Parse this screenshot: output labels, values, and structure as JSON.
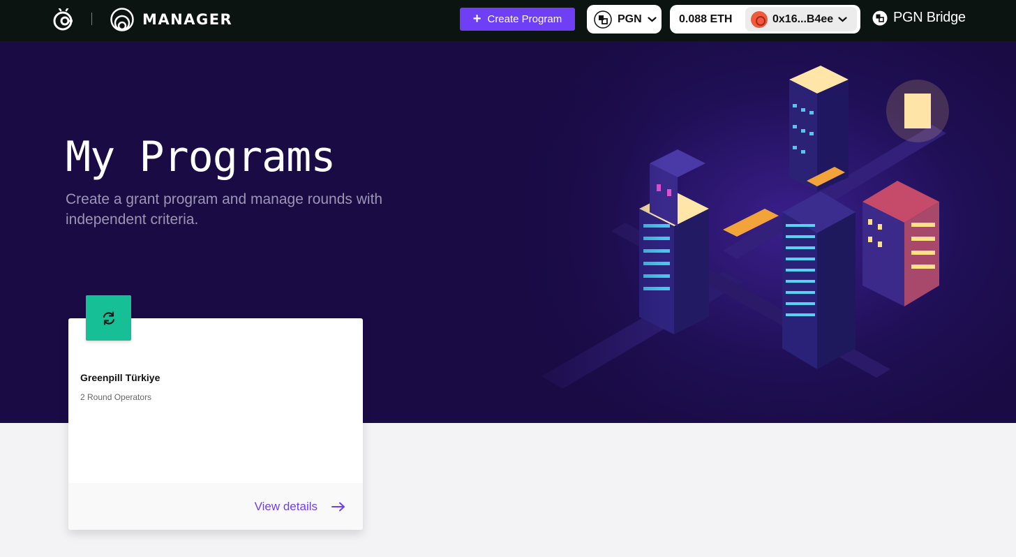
{
  "nav": {
    "brand_text": "MANAGER",
    "create_button_label": "Create Program",
    "network": "PGN",
    "wallet_balance": "0.088 ETH",
    "wallet_address": "0x16...B4ee",
    "bridge_label": "PGN Bridge"
  },
  "hero": {
    "title": "My Programs",
    "subtitle": "Create a grant program and manage rounds with independent criteria."
  },
  "programs": [
    {
      "name": "Greenpill Türkiye",
      "operators": "2 Round Operators",
      "link_label": "View details"
    }
  ],
  "colors": {
    "accent": "#6f3ff5",
    "nav_bg": "#0c1412",
    "hero_bg": "#1a0b45",
    "card_icon_bg": "#17bf96",
    "page_bg": "#f3f3f5"
  },
  "icons": {
    "create_button": "plus-icon",
    "network": "pgn-logo-icon",
    "wallet_avatar": "avatar",
    "card": "refresh-icon",
    "link": "arrow-right-icon"
  }
}
